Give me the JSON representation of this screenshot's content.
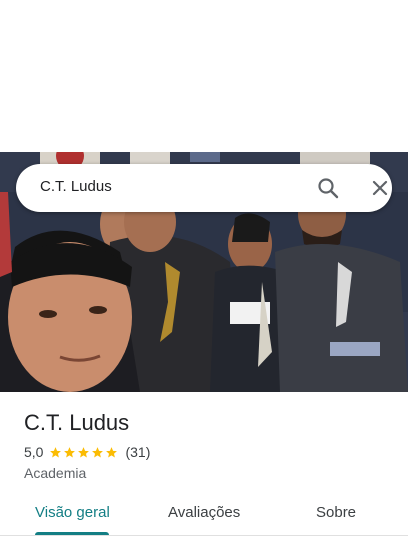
{
  "search": {
    "query": "C.T. Ludus",
    "search_icon": "search-icon",
    "close_icon": "close-icon"
  },
  "hero": {
    "image_subject": "group-photo-jiu-jitsu-academy"
  },
  "place": {
    "name": "C.T. Ludus",
    "rating": "5,0",
    "stars": 5,
    "review_count": "(31)",
    "category": "Academia"
  },
  "tabs": [
    {
      "label": "Visão geral",
      "active": true
    },
    {
      "label": "Avaliações",
      "active": false
    },
    {
      "label": "Sobre",
      "active": false
    }
  ],
  "colors": {
    "accent": "#137e84",
    "star": "#fbbc04"
  }
}
